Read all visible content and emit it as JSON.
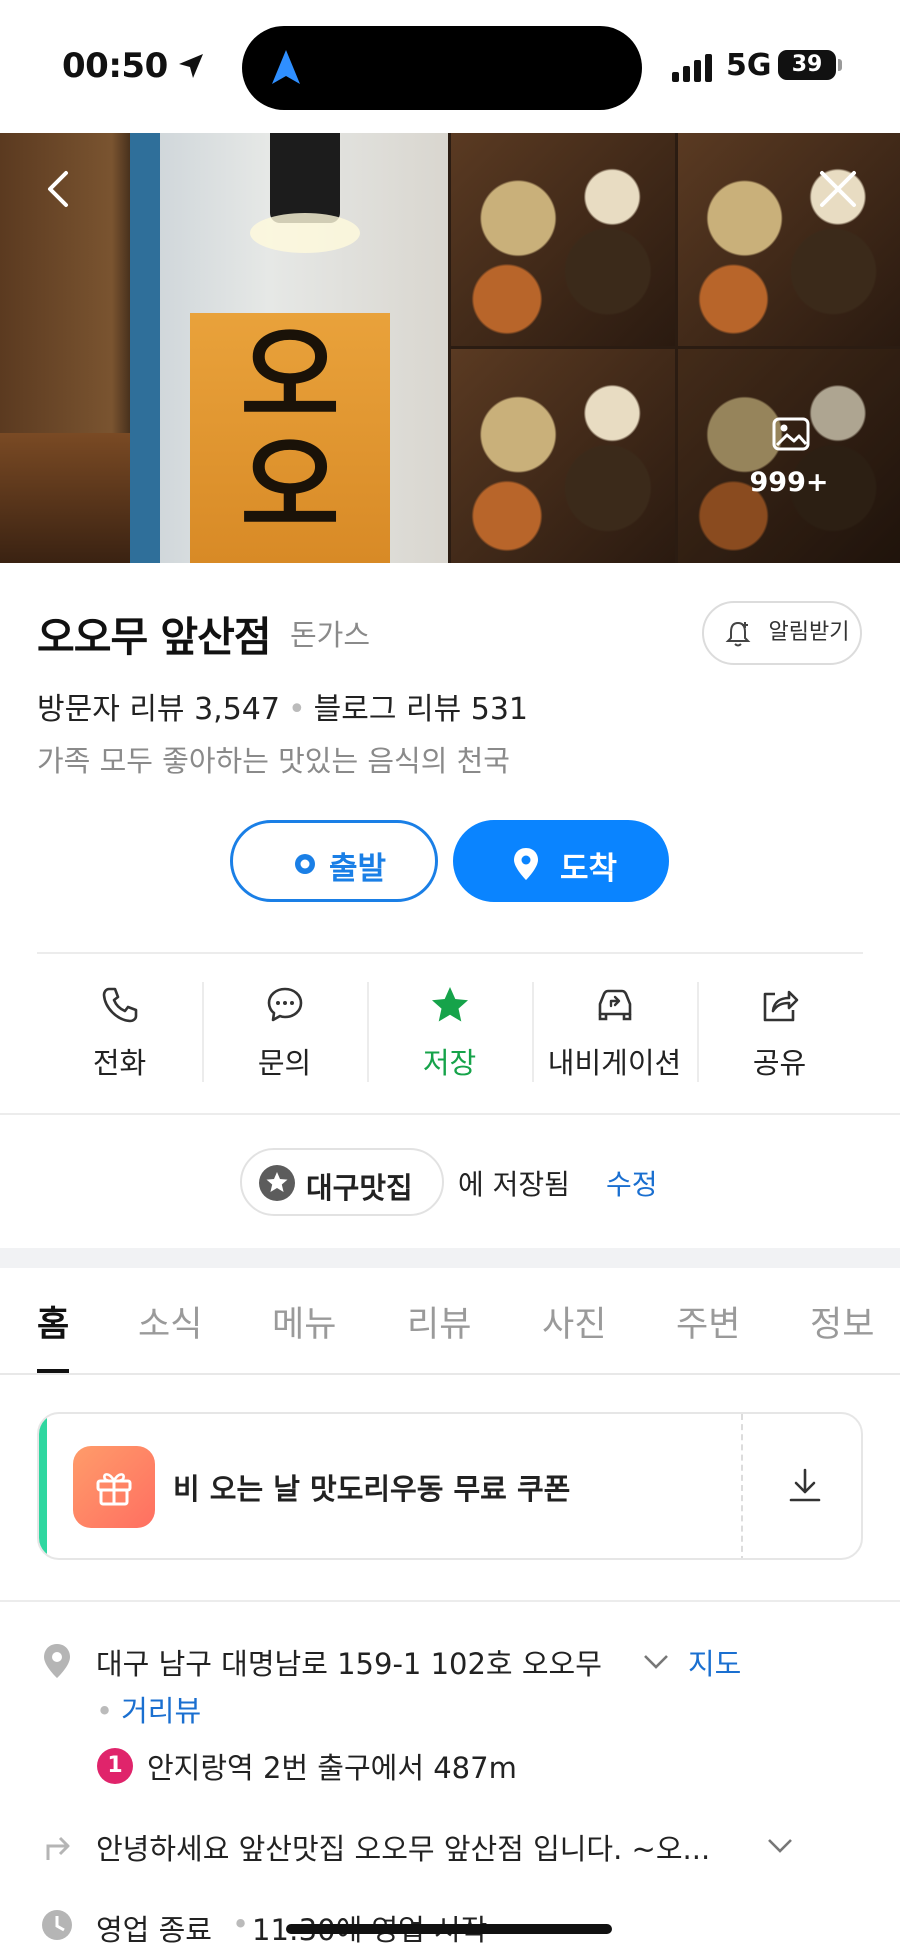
{
  "status_bar": {
    "time": "00:50",
    "network": "5G",
    "battery": "39"
  },
  "gallery": {
    "sign_text": [
      "오",
      "오"
    ],
    "photo_count": "999+",
    "icons": [
      "chevron-left-icon",
      "close-icon",
      "image-icon"
    ]
  },
  "place": {
    "name": "오오무 앞산점",
    "category": "돈가스",
    "alert_label": "알림받기",
    "visitor_reviews": "방문자 리뷰 3,547",
    "blog_reviews": "블로그 리뷰 531",
    "tagline": "가족 모두 좋아하는 맛있는 음식의 천국"
  },
  "route": {
    "depart_label": "출발",
    "arrive_label": "도착",
    "accent": "#0a84ff"
  },
  "actions": [
    {
      "label": "전화",
      "icon": "phone-icon"
    },
    {
      "label": "문의",
      "icon": "chat-icon"
    },
    {
      "label": "저장",
      "icon": "star-icon",
      "color": "#16a34a"
    },
    {
      "label": "내비게이션",
      "icon": "car-icon"
    },
    {
      "label": "공유",
      "icon": "share-icon"
    }
  ],
  "saved": {
    "list_name": "대구맛집",
    "saved_text": "에 저장됨",
    "edit_label": "수정"
  },
  "tabs": [
    "홈",
    "소식",
    "메뉴",
    "리뷰",
    "사진",
    "주변",
    "정보"
  ],
  "active_tab": "홈",
  "coupon": {
    "label": "비 오는 날 맛도리우동 무료 쿠폰",
    "accent": "#2fd7a0"
  },
  "info": {
    "address": "대구 남구 대명남로 159-1 102호 오오무",
    "map_label": "지도",
    "roadview_label": "거리뷰",
    "subway_line": "1",
    "subway_text": "안지랑역 2번 출구에서 487m",
    "description": "안녕하세요 앞산맛집 오오무 앞산점 입니다. ~오...",
    "hours_status": "영업 종료",
    "hours_detail": "11:30에 영업 시작"
  }
}
